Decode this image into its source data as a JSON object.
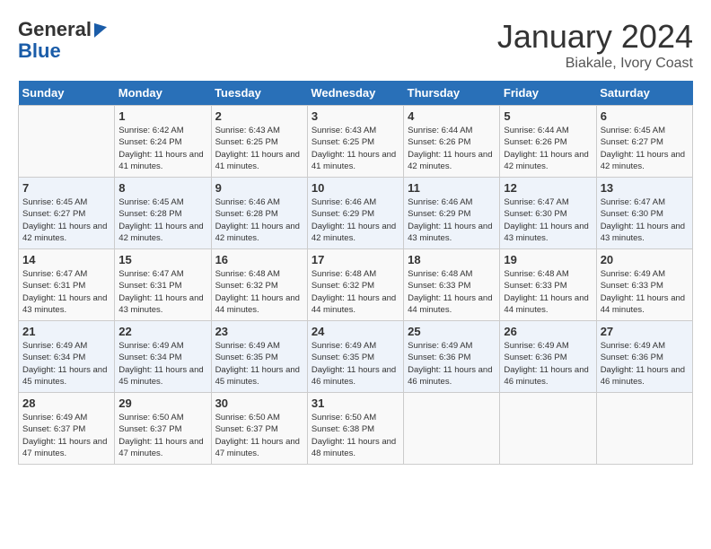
{
  "logo": {
    "line1": "General",
    "line2": "Blue"
  },
  "header": {
    "month": "January 2024",
    "location": "Biakale, Ivory Coast"
  },
  "weekdays": [
    "Sunday",
    "Monday",
    "Tuesday",
    "Wednesday",
    "Thursday",
    "Friday",
    "Saturday"
  ],
  "weeks": [
    [
      {
        "day": "",
        "sunrise": "",
        "sunset": "",
        "daylight": ""
      },
      {
        "day": "1",
        "sunrise": "Sunrise: 6:42 AM",
        "sunset": "Sunset: 6:24 PM",
        "daylight": "Daylight: 11 hours and 41 minutes."
      },
      {
        "day": "2",
        "sunrise": "Sunrise: 6:43 AM",
        "sunset": "Sunset: 6:25 PM",
        "daylight": "Daylight: 11 hours and 41 minutes."
      },
      {
        "day": "3",
        "sunrise": "Sunrise: 6:43 AM",
        "sunset": "Sunset: 6:25 PM",
        "daylight": "Daylight: 11 hours and 41 minutes."
      },
      {
        "day": "4",
        "sunrise": "Sunrise: 6:44 AM",
        "sunset": "Sunset: 6:26 PM",
        "daylight": "Daylight: 11 hours and 42 minutes."
      },
      {
        "day": "5",
        "sunrise": "Sunrise: 6:44 AM",
        "sunset": "Sunset: 6:26 PM",
        "daylight": "Daylight: 11 hours and 42 minutes."
      },
      {
        "day": "6",
        "sunrise": "Sunrise: 6:45 AM",
        "sunset": "Sunset: 6:27 PM",
        "daylight": "Daylight: 11 hours and 42 minutes."
      }
    ],
    [
      {
        "day": "7",
        "sunrise": "Sunrise: 6:45 AM",
        "sunset": "Sunset: 6:27 PM",
        "daylight": "Daylight: 11 hours and 42 minutes."
      },
      {
        "day": "8",
        "sunrise": "Sunrise: 6:45 AM",
        "sunset": "Sunset: 6:28 PM",
        "daylight": "Daylight: 11 hours and 42 minutes."
      },
      {
        "day": "9",
        "sunrise": "Sunrise: 6:46 AM",
        "sunset": "Sunset: 6:28 PM",
        "daylight": "Daylight: 11 hours and 42 minutes."
      },
      {
        "day": "10",
        "sunrise": "Sunrise: 6:46 AM",
        "sunset": "Sunset: 6:29 PM",
        "daylight": "Daylight: 11 hours and 42 minutes."
      },
      {
        "day": "11",
        "sunrise": "Sunrise: 6:46 AM",
        "sunset": "Sunset: 6:29 PM",
        "daylight": "Daylight: 11 hours and 43 minutes."
      },
      {
        "day": "12",
        "sunrise": "Sunrise: 6:47 AM",
        "sunset": "Sunset: 6:30 PM",
        "daylight": "Daylight: 11 hours and 43 minutes."
      },
      {
        "day": "13",
        "sunrise": "Sunrise: 6:47 AM",
        "sunset": "Sunset: 6:30 PM",
        "daylight": "Daylight: 11 hours and 43 minutes."
      }
    ],
    [
      {
        "day": "14",
        "sunrise": "Sunrise: 6:47 AM",
        "sunset": "Sunset: 6:31 PM",
        "daylight": "Daylight: 11 hours and 43 minutes."
      },
      {
        "day": "15",
        "sunrise": "Sunrise: 6:47 AM",
        "sunset": "Sunset: 6:31 PM",
        "daylight": "Daylight: 11 hours and 43 minutes."
      },
      {
        "day": "16",
        "sunrise": "Sunrise: 6:48 AM",
        "sunset": "Sunset: 6:32 PM",
        "daylight": "Daylight: 11 hours and 44 minutes."
      },
      {
        "day": "17",
        "sunrise": "Sunrise: 6:48 AM",
        "sunset": "Sunset: 6:32 PM",
        "daylight": "Daylight: 11 hours and 44 minutes."
      },
      {
        "day": "18",
        "sunrise": "Sunrise: 6:48 AM",
        "sunset": "Sunset: 6:33 PM",
        "daylight": "Daylight: 11 hours and 44 minutes."
      },
      {
        "day": "19",
        "sunrise": "Sunrise: 6:48 AM",
        "sunset": "Sunset: 6:33 PM",
        "daylight": "Daylight: 11 hours and 44 minutes."
      },
      {
        "day": "20",
        "sunrise": "Sunrise: 6:49 AM",
        "sunset": "Sunset: 6:33 PM",
        "daylight": "Daylight: 11 hours and 44 minutes."
      }
    ],
    [
      {
        "day": "21",
        "sunrise": "Sunrise: 6:49 AM",
        "sunset": "Sunset: 6:34 PM",
        "daylight": "Daylight: 11 hours and 45 minutes."
      },
      {
        "day": "22",
        "sunrise": "Sunrise: 6:49 AM",
        "sunset": "Sunset: 6:34 PM",
        "daylight": "Daylight: 11 hours and 45 minutes."
      },
      {
        "day": "23",
        "sunrise": "Sunrise: 6:49 AM",
        "sunset": "Sunset: 6:35 PM",
        "daylight": "Daylight: 11 hours and 45 minutes."
      },
      {
        "day": "24",
        "sunrise": "Sunrise: 6:49 AM",
        "sunset": "Sunset: 6:35 PM",
        "daylight": "Daylight: 11 hours and 46 minutes."
      },
      {
        "day": "25",
        "sunrise": "Sunrise: 6:49 AM",
        "sunset": "Sunset: 6:36 PM",
        "daylight": "Daylight: 11 hours and 46 minutes."
      },
      {
        "day": "26",
        "sunrise": "Sunrise: 6:49 AM",
        "sunset": "Sunset: 6:36 PM",
        "daylight": "Daylight: 11 hours and 46 minutes."
      },
      {
        "day": "27",
        "sunrise": "Sunrise: 6:49 AM",
        "sunset": "Sunset: 6:36 PM",
        "daylight": "Daylight: 11 hours and 46 minutes."
      }
    ],
    [
      {
        "day": "28",
        "sunrise": "Sunrise: 6:49 AM",
        "sunset": "Sunset: 6:37 PM",
        "daylight": "Daylight: 11 hours and 47 minutes."
      },
      {
        "day": "29",
        "sunrise": "Sunrise: 6:50 AM",
        "sunset": "Sunset: 6:37 PM",
        "daylight": "Daylight: 11 hours and 47 minutes."
      },
      {
        "day": "30",
        "sunrise": "Sunrise: 6:50 AM",
        "sunset": "Sunset: 6:37 PM",
        "daylight": "Daylight: 11 hours and 47 minutes."
      },
      {
        "day": "31",
        "sunrise": "Sunrise: 6:50 AM",
        "sunset": "Sunset: 6:38 PM",
        "daylight": "Daylight: 11 hours and 48 minutes."
      },
      {
        "day": "",
        "sunrise": "",
        "sunset": "",
        "daylight": ""
      },
      {
        "day": "",
        "sunrise": "",
        "sunset": "",
        "daylight": ""
      },
      {
        "day": "",
        "sunrise": "",
        "sunset": "",
        "daylight": ""
      }
    ]
  ]
}
